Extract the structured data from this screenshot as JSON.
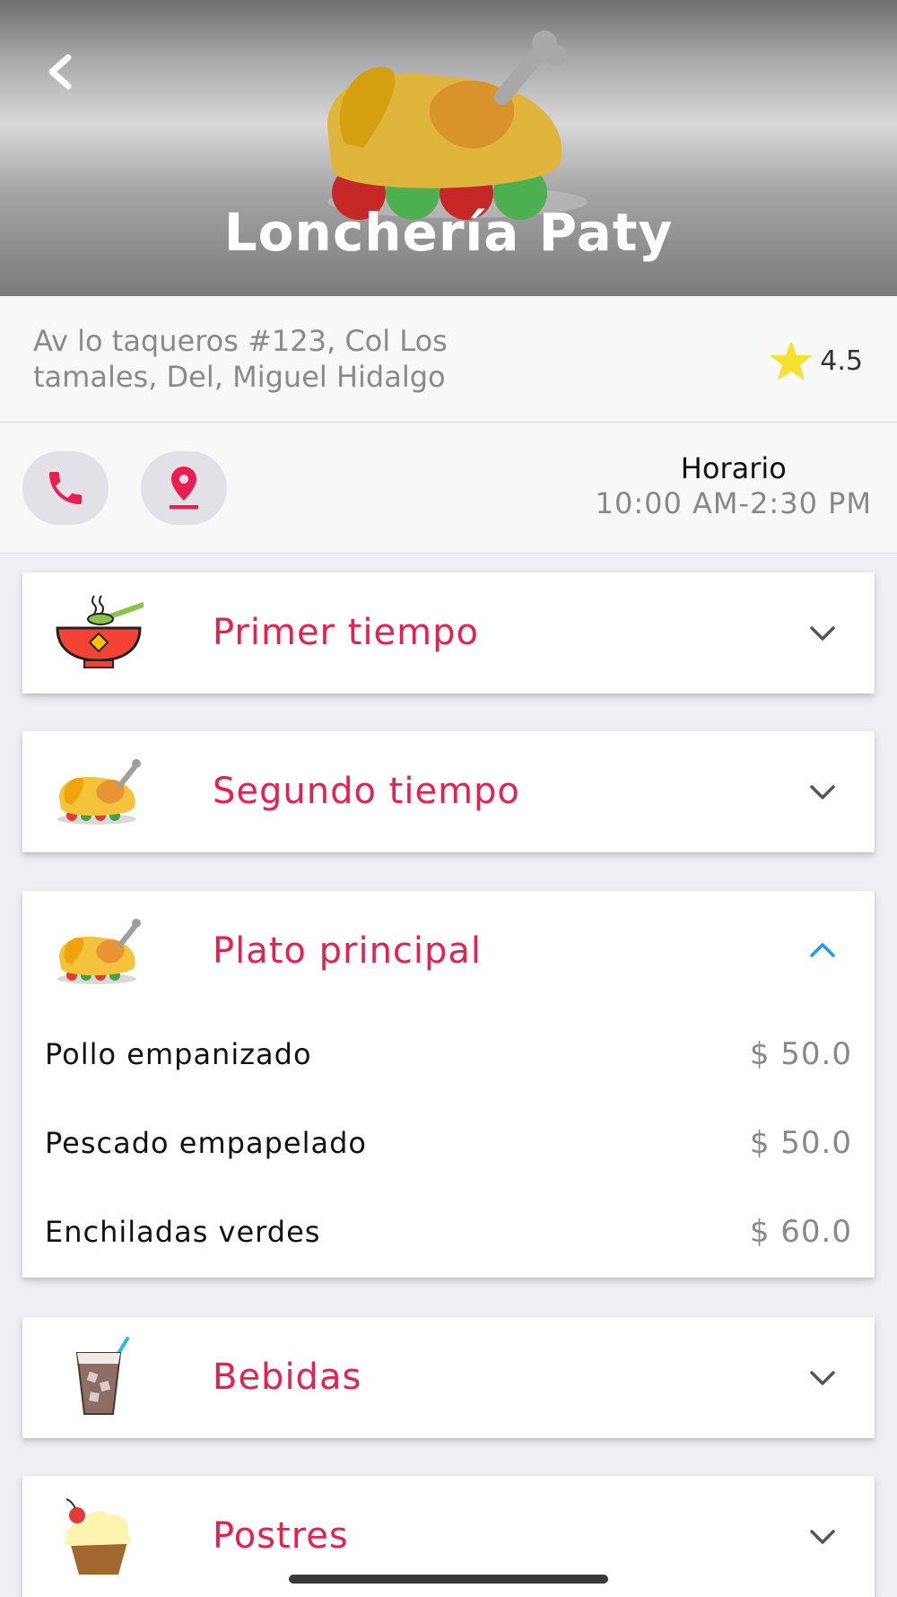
{
  "restaurant": {
    "name": "Lonchería Paty",
    "address": "Av lo taqueros #123, Col Los tamales, Del, Miguel Hidalgo",
    "rating": "4.5"
  },
  "hours": {
    "label": "Horario",
    "value": "10:00 AM-2:30 PM"
  },
  "categories": [
    {
      "label": "Primer tiempo",
      "icon": "soup-bowl-icon",
      "expanded": false
    },
    {
      "label": "Segundo tiempo",
      "icon": "roast-chicken-icon",
      "expanded": false
    },
    {
      "label": "Plato principal",
      "icon": "roast-chicken-icon",
      "expanded": true,
      "items": [
        {
          "name": "Pollo empanizado",
          "price": "$ 50.0"
        },
        {
          "name": "Pescado empapelado",
          "price": "$ 50.0"
        },
        {
          "name": "Enchiladas verdes",
          "price": "$ 60.0"
        }
      ]
    },
    {
      "label": "Bebidas",
      "icon": "iced-drink-icon",
      "expanded": false
    },
    {
      "label": "Postres",
      "icon": "cupcake-icon",
      "expanded": false
    }
  ],
  "colors": {
    "accent": "#e91e51",
    "chevron_open": "#2196f3",
    "chevron_closed": "#555555",
    "star": "#f5e12d"
  }
}
